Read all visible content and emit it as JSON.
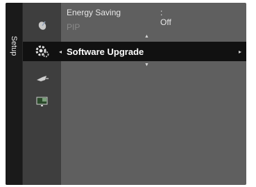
{
  "sidebar": {
    "tab_label": "Setup",
    "icons": [
      "satellite-dish-icon",
      "gear-icon",
      "input-plug-icon",
      "picture-in-picture-icon"
    ]
  },
  "menu": {
    "items": [
      {
        "label": "Energy Saving",
        "value": ": Off",
        "state": "normal"
      },
      {
        "label": "PIP",
        "value": "",
        "state": "disabled"
      },
      {
        "label": "Software Upgrade",
        "value": "",
        "state": "selected"
      }
    ]
  },
  "colors": {
    "screen_bg": "#5f5f5f",
    "icon_column_bg": "#3e3e3e",
    "highlight_bg": "#111111",
    "text": "#e8e8e8",
    "disabled_text": "#8a8a8a"
  }
}
